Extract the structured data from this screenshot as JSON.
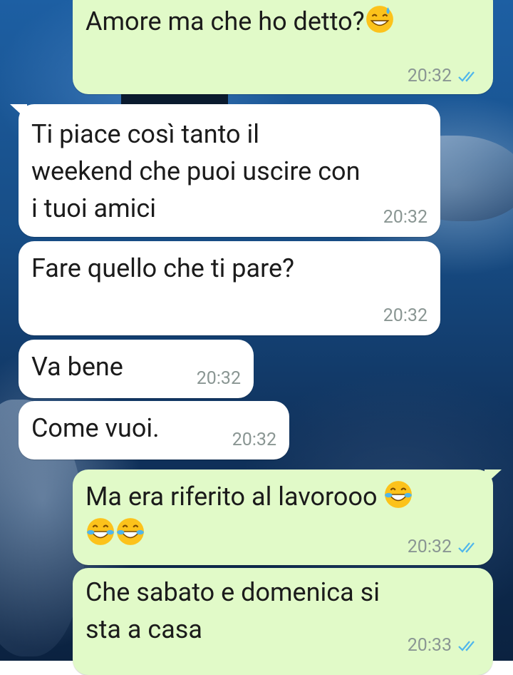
{
  "chat": {
    "messages": [
      {
        "direction": "out",
        "text": "Amore ma che ho detto?",
        "emojis": [
          "grinning-sweat"
        ],
        "time": "20:32",
        "status": "read"
      },
      {
        "direction": "in",
        "text": "Ti piace così tanto il\nweekend che puoi uscire con\ni tuoi amici",
        "time": "20:32"
      },
      {
        "direction": "in",
        "text": "Fare quello che ti pare?",
        "time": "20:32"
      },
      {
        "direction": "in",
        "text": "Va bene",
        "time": "20:32"
      },
      {
        "direction": "in",
        "text": "Come vuoi.",
        "time": "20:32"
      },
      {
        "direction": "out",
        "text": "Ma era riferito al lavorooo",
        "emojis": [
          "tears-of-joy",
          "tears-of-joy",
          "tears-of-joy"
        ],
        "time": "20:32",
        "status": "read"
      },
      {
        "direction": "out",
        "text": "Che sabato e domenica si\nsta a casa",
        "time": "20:33",
        "status": "read"
      }
    ]
  },
  "colors": {
    "outgoing_bubble": "#e1fac8",
    "incoming_bubble": "#ffffff",
    "read_ticks": "#4fb6ec",
    "timestamp": "#8a9693"
  },
  "icons": {
    "read_status": "double-check-icon",
    "emoji_sweat": "grinning-face-with-sweat-icon",
    "emoji_laugh": "face-with-tears-of-joy-icon"
  }
}
